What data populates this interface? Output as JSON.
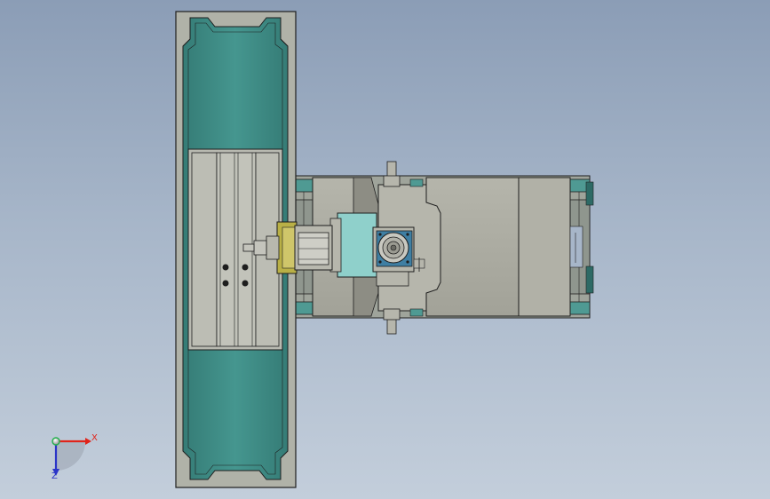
{
  "colors": {
    "background_top": "#8b9db6",
    "background_bottom": "#c3cedb",
    "teal_part": "#3f9089",
    "teal_light": "#8fd0cb",
    "grey_part": "#a9a99f",
    "grey_dark": "#8d8d84",
    "edge": "#1e1e1e",
    "axis_x": "#e0241b",
    "axis_y": "#22b14c",
    "axis_z": "#2b35c8"
  },
  "viewport": {
    "model_name": "",
    "triad": {
      "x_label": "X",
      "z_label": "Z"
    }
  }
}
